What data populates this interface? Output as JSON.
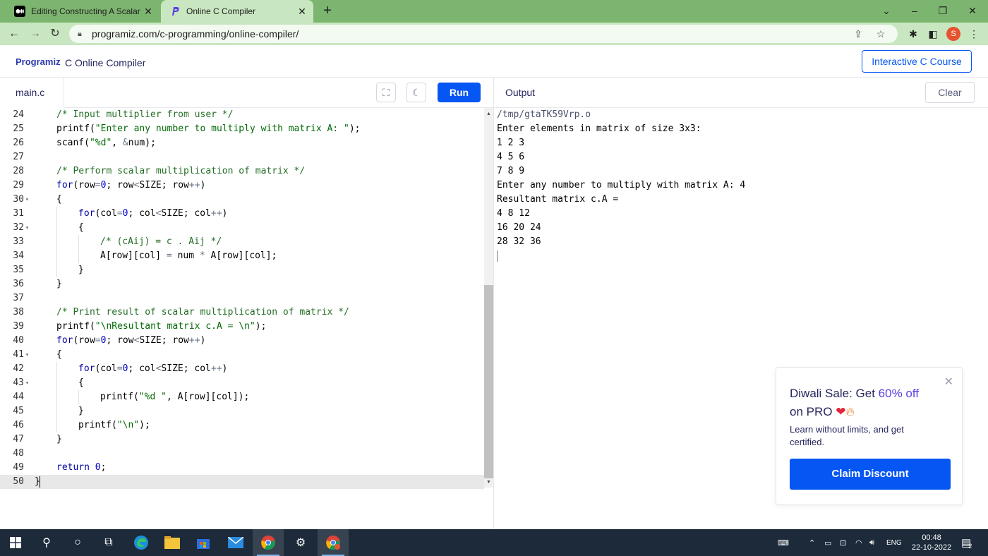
{
  "browser": {
    "tabs": [
      {
        "title": "Editing Constructing A Scalar Ma",
        "active": false,
        "favicon": "medium-icon"
      },
      {
        "title": "Online C Compiler",
        "active": true,
        "favicon": "programiz-icon"
      }
    ],
    "url": "programiz.com/c-programming/online-compiler/",
    "profile_initial": "S"
  },
  "site": {
    "logo": "Programiz",
    "title": "C Online Compiler",
    "course_button": "Interactive C Course"
  },
  "editor": {
    "filename": "main.c",
    "run_label": "Run",
    "active_line": 50,
    "lines": [
      {
        "n": "24",
        "fold": "",
        "indent": 1,
        "tokens": [
          [
            "com",
            "/* Input multiplier from user */"
          ]
        ]
      },
      {
        "n": "25",
        "fold": "",
        "indent": 1,
        "tokens": [
          [
            "pl",
            "printf("
          ],
          [
            "str",
            "\"Enter any number to multiply with matrix A: \""
          ],
          [
            "pl",
            ");"
          ]
        ]
      },
      {
        "n": "26",
        "fold": "",
        "indent": 1,
        "tokens": [
          [
            "pl",
            "scanf("
          ],
          [
            "str",
            "\"%d\""
          ],
          [
            "pl",
            ", "
          ],
          [
            "op",
            "&"
          ],
          [
            "pl",
            "num);"
          ]
        ]
      },
      {
        "n": "27",
        "fold": "",
        "indent": 0,
        "tokens": []
      },
      {
        "n": "28",
        "fold": "",
        "indent": 1,
        "tokens": [
          [
            "com",
            "/* Perform scalar multiplication of matrix */"
          ]
        ]
      },
      {
        "n": "29",
        "fold": "",
        "indent": 1,
        "tokens": [
          [
            "kw",
            "for"
          ],
          [
            "pl",
            "(row"
          ],
          [
            "op",
            "="
          ],
          [
            "num",
            "0"
          ],
          [
            "pl",
            "; row"
          ],
          [
            "op",
            "<"
          ],
          [
            "pl",
            "SIZE; row"
          ],
          [
            "op",
            "++"
          ],
          [
            "pl",
            ")"
          ]
        ]
      },
      {
        "n": "30",
        "fold": "▾",
        "indent": 1,
        "tokens": [
          [
            "pl",
            "{"
          ]
        ]
      },
      {
        "n": "31",
        "fold": "",
        "indent": 2,
        "tokens": [
          [
            "kw",
            "for"
          ],
          [
            "pl",
            "(col"
          ],
          [
            "op",
            "="
          ],
          [
            "num",
            "0"
          ],
          [
            "pl",
            "; col"
          ],
          [
            "op",
            "<"
          ],
          [
            "pl",
            "SIZE; col"
          ],
          [
            "op",
            "++"
          ],
          [
            "pl",
            ")"
          ]
        ]
      },
      {
        "n": "32",
        "fold": "▾",
        "indent": 2,
        "tokens": [
          [
            "pl",
            "{"
          ]
        ]
      },
      {
        "n": "33",
        "fold": "",
        "indent": 3,
        "tokens": [
          [
            "com",
            "/* (cAij) = c . Aij */"
          ]
        ]
      },
      {
        "n": "34",
        "fold": "",
        "indent": 3,
        "tokens": [
          [
            "pl",
            "A[row][col] "
          ],
          [
            "op",
            "="
          ],
          [
            "pl",
            " num "
          ],
          [
            "op",
            "*"
          ],
          [
            "pl",
            " A[row][col];"
          ]
        ]
      },
      {
        "n": "35",
        "fold": "",
        "indent": 2,
        "tokens": [
          [
            "pl",
            "}"
          ]
        ]
      },
      {
        "n": "36",
        "fold": "",
        "indent": 1,
        "tokens": [
          [
            "pl",
            "}"
          ]
        ]
      },
      {
        "n": "37",
        "fold": "",
        "indent": 0,
        "tokens": []
      },
      {
        "n": "38",
        "fold": "",
        "indent": 1,
        "tokens": [
          [
            "com",
            "/* Print result of scalar multiplication of matrix */"
          ]
        ]
      },
      {
        "n": "39",
        "fold": "",
        "indent": 1,
        "tokens": [
          [
            "pl",
            "printf("
          ],
          [
            "str",
            "\"\\nResultant matrix c.A = \\n\""
          ],
          [
            "pl",
            ");"
          ]
        ]
      },
      {
        "n": "40",
        "fold": "",
        "indent": 1,
        "tokens": [
          [
            "kw",
            "for"
          ],
          [
            "pl",
            "(row"
          ],
          [
            "op",
            "="
          ],
          [
            "num",
            "0"
          ],
          [
            "pl",
            "; row"
          ],
          [
            "op",
            "<"
          ],
          [
            "pl",
            "SIZE; row"
          ],
          [
            "op",
            "++"
          ],
          [
            "pl",
            ")"
          ]
        ]
      },
      {
        "n": "41",
        "fold": "▾",
        "indent": 1,
        "tokens": [
          [
            "pl",
            "{"
          ]
        ]
      },
      {
        "n": "42",
        "fold": "",
        "indent": 2,
        "tokens": [
          [
            "kw",
            "for"
          ],
          [
            "pl",
            "(col"
          ],
          [
            "op",
            "="
          ],
          [
            "num",
            "0"
          ],
          [
            "pl",
            "; col"
          ],
          [
            "op",
            "<"
          ],
          [
            "pl",
            "SIZE; col"
          ],
          [
            "op",
            "++"
          ],
          [
            "pl",
            ")"
          ]
        ]
      },
      {
        "n": "43",
        "fold": "▾",
        "indent": 2,
        "tokens": [
          [
            "pl",
            "{"
          ]
        ]
      },
      {
        "n": "44",
        "fold": "",
        "indent": 3,
        "tokens": [
          [
            "pl",
            "printf("
          ],
          [
            "str",
            "\"%d \""
          ],
          [
            "pl",
            ", A[row][col]);"
          ]
        ]
      },
      {
        "n": "45",
        "fold": "",
        "indent": 2,
        "tokens": [
          [
            "pl",
            "}"
          ]
        ]
      },
      {
        "n": "46",
        "fold": "",
        "indent": 2,
        "tokens": [
          [
            "pl",
            "printf("
          ],
          [
            "str",
            "\"\\n\""
          ],
          [
            "pl",
            ");"
          ]
        ]
      },
      {
        "n": "47",
        "fold": "",
        "indent": 1,
        "tokens": [
          [
            "pl",
            "}"
          ]
        ]
      },
      {
        "n": "48",
        "fold": "",
        "indent": 0,
        "tokens": []
      },
      {
        "n": "49",
        "fold": "",
        "indent": 1,
        "tokens": [
          [
            "kw",
            "return"
          ],
          [
            "pl",
            " "
          ],
          [
            "num",
            "0"
          ],
          [
            "pl",
            ";"
          ]
        ]
      },
      {
        "n": "50",
        "fold": "",
        "indent": 0,
        "tokens": [
          [
            "pl",
            "}"
          ]
        ]
      }
    ]
  },
  "output": {
    "label": "Output",
    "clear_label": "Clear",
    "lines": [
      "/tmp/gtaTK59Vrp.o",
      "Enter elements in matrix of size 3x3:",
      "1 2 3",
      "4 5 6",
      "7 8 9",
      "Enter any number to multiply with matrix A: 4",
      "Resultant matrix c.A =",
      "4 8 12",
      "16 20 24",
      "28 32 36"
    ]
  },
  "promo": {
    "heading_pre": "Diwali Sale: Get ",
    "heading_highlight": "60% off",
    "heading_post": "on PRO",
    "subtext": "Learn without limits, and get certified.",
    "button": "Claim Discount"
  },
  "taskbar": {
    "language": "ENG",
    "time": "00:48",
    "date": "22-10-2022",
    "notification_count": "2"
  },
  "colors": {
    "brand_blue": "#0556f3",
    "tab_strip": "#7cb56f",
    "taskbar": "#1c2a3a"
  }
}
